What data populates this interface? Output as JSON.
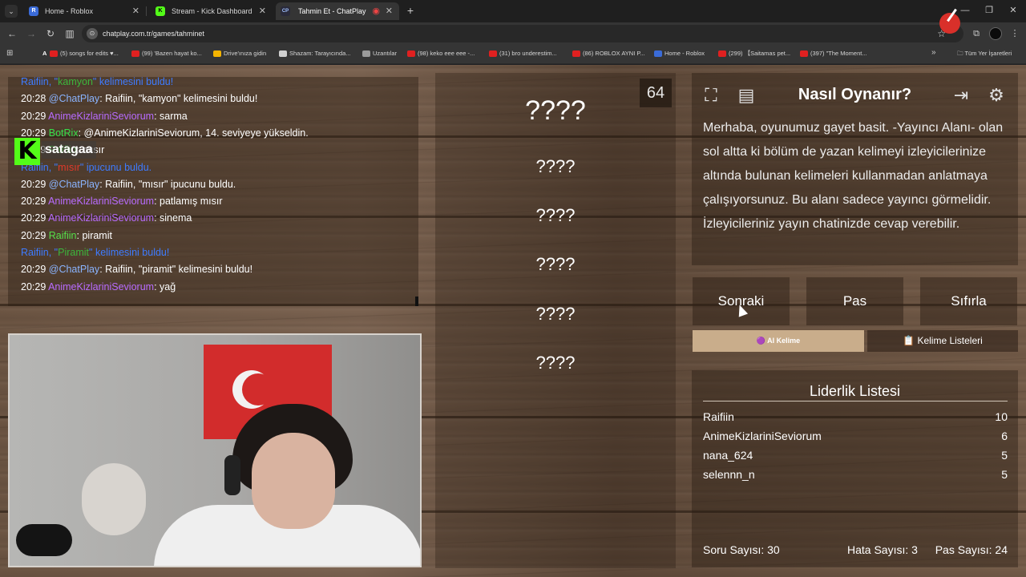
{
  "browser": {
    "tabs": [
      {
        "title": "Home - Roblox",
        "favicon_text": "R",
        "favicon_color": "#3a6bd8",
        "active": false
      },
      {
        "title": "Stream - Kick Dashboard",
        "favicon_text": "K",
        "favicon_color": "#53fc18",
        "active": false
      },
      {
        "title": "Tahmin Et - ChatPlay",
        "favicon_text": "CP",
        "favicon_color": "#2a2a3a",
        "active": true
      }
    ],
    "url": "chatplay.com.tr/games/tahminet",
    "bookmarks": [
      {
        "label": "(5) songs for edits ♥...",
        "color": "#e02020"
      },
      {
        "label": "(99) 'Bazen hayat ko...",
        "color": "#e02020"
      },
      {
        "label": "Drive'ınıza gidin",
        "color": "#f4b400"
      },
      {
        "label": "Shazam: Tarayıcında...",
        "color": "#cfcfcf"
      },
      {
        "label": "Uzantılar",
        "color": "#9a9a9a"
      },
      {
        "label": "(98) keko eee eee -...",
        "color": "#e02020"
      },
      {
        "label": "(31) bro underestim...",
        "color": "#e02020"
      },
      {
        "label": "(86) ROBLOX AYNI P...",
        "color": "#e02020"
      },
      {
        "label": "Home - Roblox",
        "color": "#3a6bd8"
      },
      {
        "label": "(299) 【Saitamas pet...",
        "color": "#e02020"
      },
      {
        "label": "(397) \"The Moment...",
        "color": "#e02020"
      }
    ],
    "all_bookmarks_label": "Tüm Yer İşaretleri"
  },
  "chat": {
    "messages": [
      {
        "type": "sys",
        "parts": [
          {
            "t": "Raifiin, \"",
            "c": "sys"
          },
          {
            "t": "kamyon",
            "c": "hl"
          },
          {
            "t": "\" kelimesini buldu!",
            "c": "sys"
          }
        ]
      },
      {
        "type": "msg",
        "time": "20:28",
        "user": "@ChatPlay",
        "ucls": "u-chatplay",
        "text": ": Raifiin, \"kamyon\" kelimesini buldu!"
      },
      {
        "type": "msg",
        "time": "20:29",
        "user": "AnimeKizlariniSeviorum",
        "ucls": "u-anime",
        "text": ": sarma"
      },
      {
        "type": "msg",
        "time": "20:29",
        "user": "BotRix",
        "ucls": "u-botrix",
        "text": ": @AnimeKizlariniSeviorum, 14. seviyeye yükseldin."
      },
      {
        "type": "msg",
        "time": "20:29",
        "user": "Raifiin",
        "ucls": "u-raifiin",
        "text": ": mısır"
      },
      {
        "type": "sys",
        "parts": [
          {
            "t": "Raifiin, \"",
            "c": "sys"
          },
          {
            "t": "mısır",
            "c": "hl-red"
          },
          {
            "t": "\" ipucunu buldu.",
            "c": "sys"
          }
        ]
      },
      {
        "type": "msg",
        "time": "20:29",
        "user": "@ChatPlay",
        "ucls": "u-chatplay",
        "text": ": Raifiin, \"mısır\" ipucunu buldu."
      },
      {
        "type": "msg",
        "time": "20:29",
        "user": "AnimeKizlariniSeviorum",
        "ucls": "u-anime",
        "text": ": patlamış mısır"
      },
      {
        "type": "msg",
        "time": "20:29",
        "user": "AnimeKizlariniSeviorum",
        "ucls": "u-anime",
        "text": ": sinema"
      },
      {
        "type": "msg",
        "time": "20:29",
        "user": "Raifiin",
        "ucls": "u-raifiin",
        "text": ": piramit"
      },
      {
        "type": "sys",
        "parts": [
          {
            "t": "Raifiin, \"",
            "c": "sys"
          },
          {
            "t": "Piramit",
            "c": "hl"
          },
          {
            "t": "\" kelimesini buldu!",
            "c": "sys"
          }
        ]
      },
      {
        "type": "msg",
        "time": "20:29",
        "user": "@ChatPlay",
        "ucls": "u-chatplay",
        "text": ": Raifiin, \"piramit\" kelimesini buldu!"
      },
      {
        "type": "msg",
        "time": "20:29",
        "user": "AnimeKizlariniSeviorum",
        "ucls": "u-anime",
        "text": ": yağ"
      }
    ],
    "overlay_logo": "K",
    "overlay_channel": "satagaa"
  },
  "game": {
    "counter": "64",
    "words": [
      "????",
      "????",
      "????",
      "????",
      "????",
      "????"
    ]
  },
  "howto": {
    "title": "Nasıl Oynanır?",
    "text": "Merhaba, oyunumuz gayet basit. -Yayıncı Alanı- olan sol altta ki bölüm de yazan kelimeyi izleyicilerinize altında bulunan kelimeleri kullanmadan anlatmaya çalışıyorsunuz. Bu alanı sadece yayıncı görmelidir. İzleyicileriniz yayın chatinizde cevap verebilir."
  },
  "actions": {
    "next": "Sonraki",
    "pass": "Pas",
    "reset": "Sıfırla"
  },
  "tabs": {
    "ai": "🟣 AI Kelime",
    "lists": "📋 Kelime Listeleri"
  },
  "leaderboard": {
    "title": "Liderlik Listesi",
    "rows": [
      {
        "name": "Raifiin",
        "score": "10"
      },
      {
        "name": "AnimeKizlariniSeviorum",
        "score": "6"
      },
      {
        "name": "nana_624",
        "score": "5"
      },
      {
        "name": "selennn_n",
        "score": "5"
      }
    ],
    "questions": "Soru Sayısı: 30",
    "errors": "Hata Sayısı: 3",
    "passes": "Pas Sayısı: 24"
  },
  "icons": [
    "fullscreen-icon",
    "notes-icon",
    "logout-icon",
    "settings-gear-icon"
  ]
}
